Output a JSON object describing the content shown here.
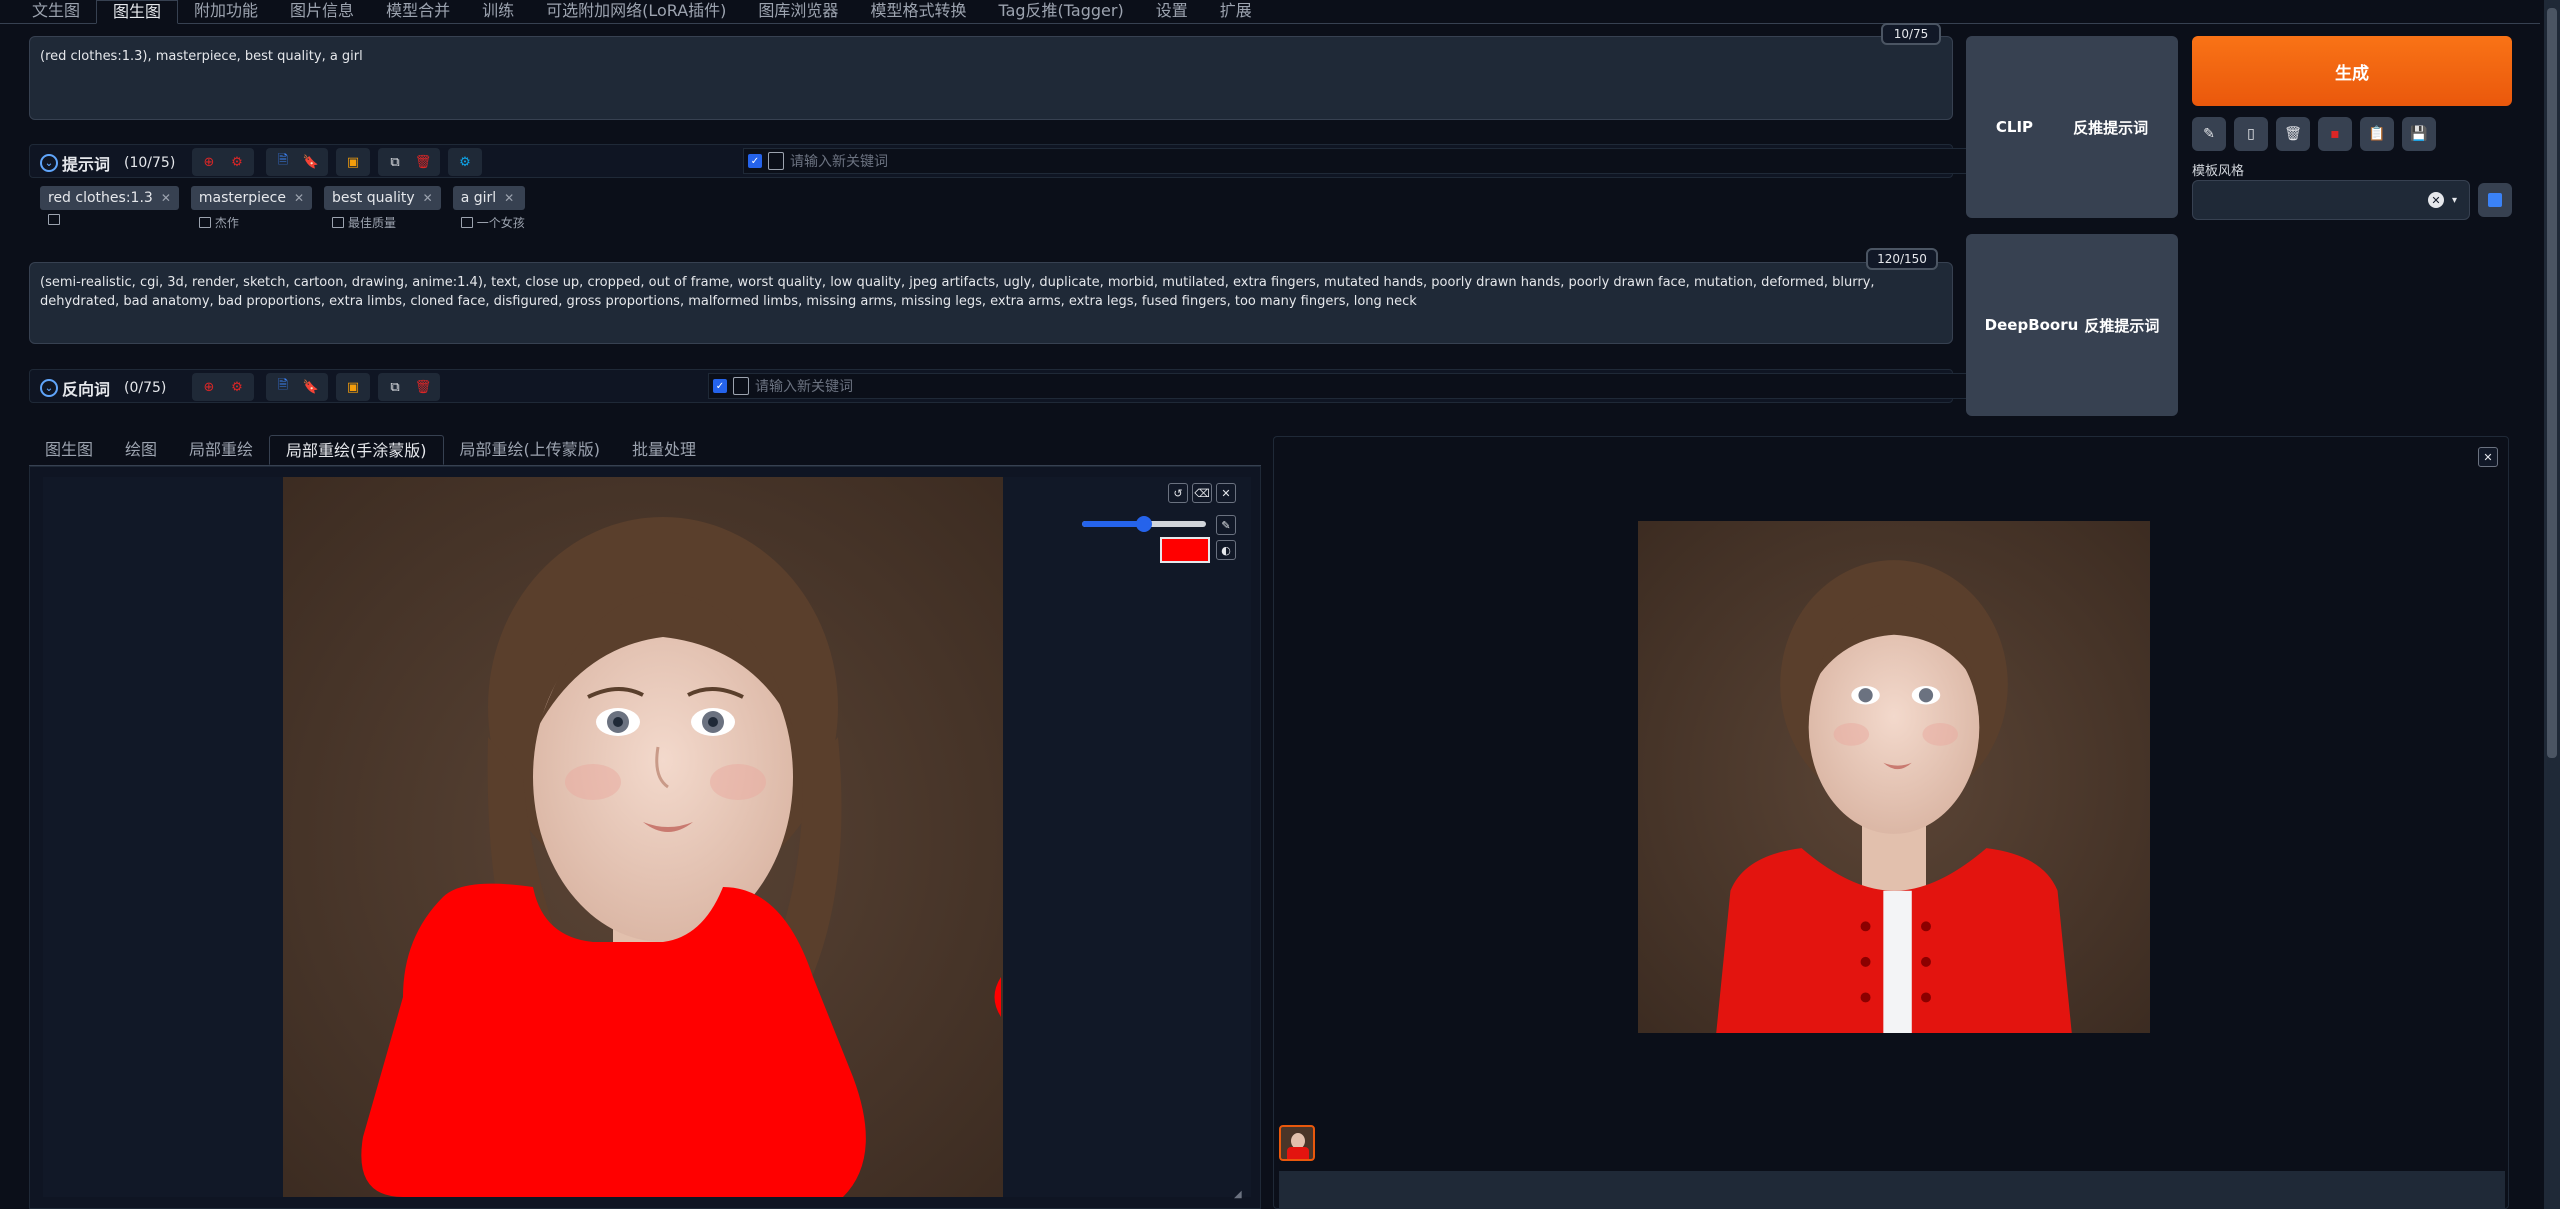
{
  "top_tabs": [
    "文生图",
    "图生图",
    "附加功能",
    "图片信息",
    "模型合并",
    "训练",
    "可选附加网络(LoRA插件)",
    "图库浏览器",
    "模型格式转换",
    "Tag反推(Tagger)",
    "设置",
    "扩展"
  ],
  "active_top_tab": "图生图",
  "prompt": {
    "text": "(red clothes:1.3), masterpiece, best quality, a girl",
    "counter": "10/75"
  },
  "prompt_tags": {
    "title": "提示词",
    "count": "(10/75)",
    "placeholder": "请输入新关键词",
    "chips": [
      {
        "label": "red clothes:1.3",
        "sub": ""
      },
      {
        "label": "masterpiece",
        "sub": "杰作"
      },
      {
        "label": "best quality",
        "sub": "最佳质量"
      },
      {
        "label": "a girl",
        "sub": "一个女孩"
      }
    ]
  },
  "negative": {
    "text": "(semi-realistic, cgi, 3d, render, sketch, cartoon, drawing, anime:1.4), text, close up, cropped, out of frame, worst quality, low quality, jpeg artifacts, ugly, duplicate, morbid, mutilated, extra fingers, mutated hands, poorly drawn hands, poorly drawn face, mutation, deformed, blurry, dehydrated, bad anatomy, bad proportions, extra limbs, cloned face, disfigured, gross proportions, malformed limbs, missing arms, missing legs, extra arms, extra legs, fused fingers, too many fingers, long neck",
    "counter": "120/150"
  },
  "negative_tags": {
    "title": "反向词",
    "count": "(0/75)",
    "placeholder": "请输入新关键词"
  },
  "interrogate": {
    "clip_label": "CLIP",
    "clip_action": "反推提示词",
    "deepbooru_label": "DeepBooru",
    "deepbooru_action": "反推提示词"
  },
  "generate_label": "生成",
  "style_label": "模板风格",
  "image_tabs": [
    "图生图",
    "绘图",
    "局部重绘",
    "局部重绘(手涂蒙版)",
    "局部重绘(上传蒙版)",
    "批量处理"
  ],
  "active_image_tab": "局部重绘(手涂蒙版)",
  "brush": {
    "size_fraction": 0.5,
    "color": "#ff0000"
  },
  "colors": {
    "accent": "#ea580c",
    "mask": "#ff0000",
    "bg": "#0b0f19"
  }
}
